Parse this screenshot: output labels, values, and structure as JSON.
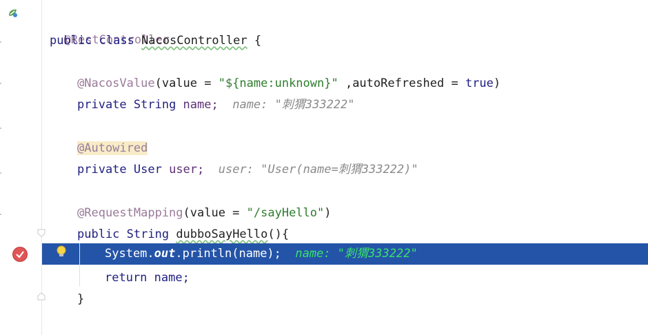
{
  "editor": {
    "lines": {
      "l1": "@RestController",
      "l2_kw": "public class ",
      "l2_name": "NacosController",
      "l2_end": " {",
      "l4_ann": "@NacosValue",
      "l4_a": "(value = ",
      "l4_str": "\"${name:unknown}\"",
      "l4_b": " ,autoRefreshed = ",
      "l4_true": "true",
      "l4_c": ")",
      "l5_kw": "private ",
      "l5_type": "String ",
      "l5_field": "name;",
      "l5_hint": "name: \"刺猬333222\"",
      "l7_ann": "@Autowired",
      "l8_kw": "private ",
      "l8_type": "User ",
      "l8_field": "user;",
      "l8_hint": "user: \"User(name=刺猬333222)\"",
      "l10_ann": "@RequestMapping",
      "l10_a": "(value = ",
      "l10_str": "\"/sayHello\"",
      "l10_c": ")",
      "l11_kw": "public ",
      "l11_type": "String ",
      "l11_name": "dubboSayHello",
      "l11_end": "(){",
      "l12_a": "System.",
      "l12_out": "out",
      "l12_b": ".println(name);",
      "l12_hint": "name: \"刺猬333222\"",
      "l13": "return name;",
      "l14": "}"
    }
  },
  "gutter": {
    "breakpoint_icon": "breakpoint-check-icon",
    "bean_icon": "spring-bean-icon",
    "bulb_icon": "lightbulb-icon"
  },
  "colors": {
    "execution_line": "#2454a8",
    "breakpoint": "#e05555",
    "inline_hint_active": "#39e36a"
  }
}
